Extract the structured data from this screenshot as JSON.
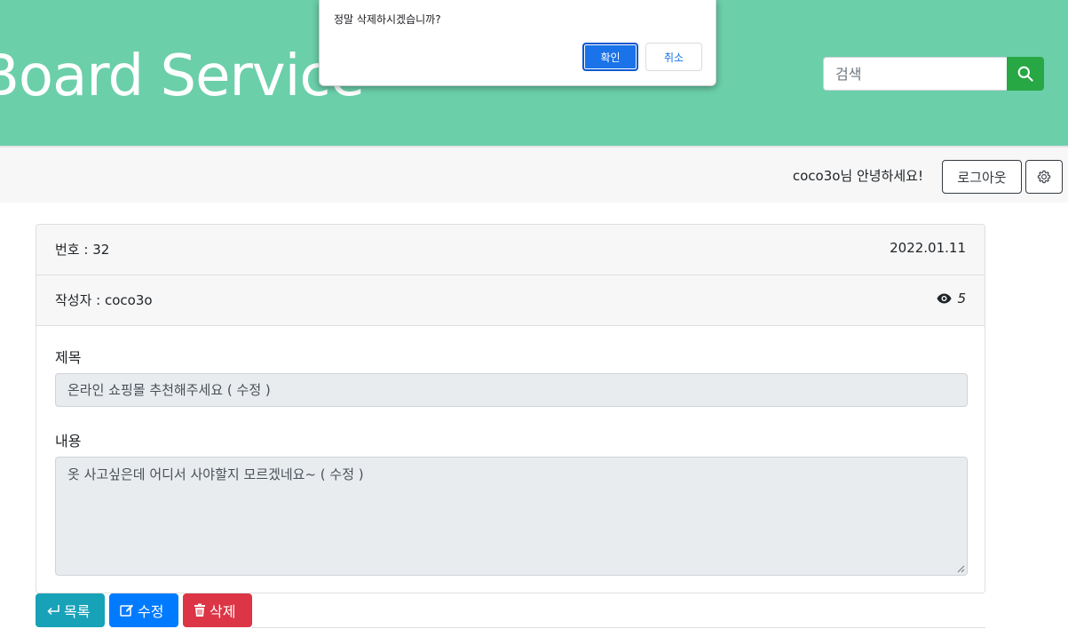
{
  "header": {
    "brand": "Board Service",
    "search_placeholder": "검색"
  },
  "userbar": {
    "greeting": "coco3o님 안녕하세요!",
    "logout_label": "로그아웃"
  },
  "post": {
    "number_label": "번호 : 32",
    "date": "2022.01.11",
    "author_label": "작성자 : coco3o",
    "views": "5",
    "title_label": "제목",
    "title_value": "온라인 쇼핑몰 추천해주세요 ( 수정 )",
    "content_label": "내용",
    "content_value": "옷 사고싶은데 어디서 사야할지 모르겠네요~ ( 수정 )"
  },
  "actions": {
    "list_label": "목록",
    "edit_label": "수정",
    "delete_label": "삭제"
  },
  "dialog": {
    "message": "정말 삭제하시겠습니까?",
    "ok_label": "확인",
    "cancel_label": "취소"
  },
  "colors": {
    "header_bg": "#6bcfaa",
    "search_button": "#28a745",
    "list_button": "#17a2b8",
    "edit_button": "#007bff",
    "delete_button": "#dc3545",
    "dialog_ok": "#1a73e8"
  },
  "icons": {
    "search": "search-icon",
    "settings": "gear-icon",
    "views": "eye-icon",
    "list": "return-arrow-icon",
    "edit": "edit-icon",
    "delete": "trash-icon"
  }
}
